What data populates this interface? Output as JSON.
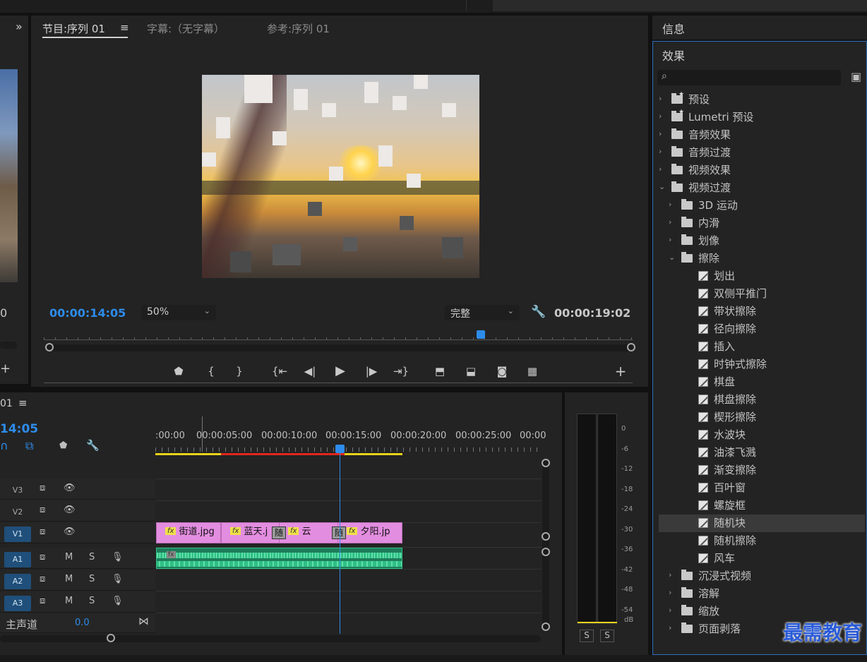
{
  "program_monitor": {
    "tabs": [
      "节目:序列 01",
      "字幕:（无字幕）",
      "参考:序列 01"
    ],
    "current_timecode": "00:00:14:05",
    "zoom": "50%",
    "quality": "完整",
    "duration_timecode": "00:00:19:02",
    "playhead_fraction": 0.74,
    "menu_icon": "hamburger-icon"
  },
  "source_panel": {
    "expand_icon": "double-chevron-right-icon",
    "partial_value": "0"
  },
  "timeline": {
    "sequence_name": "01",
    "current_timecode": "14:05",
    "ruler_labels": [
      ":00:00",
      "00:00:05:00",
      "00:00:10:00",
      "00:00:15:00",
      "00:00:20:00",
      "00:00:25:00",
      "00:00"
    ],
    "tracks": [
      {
        "label": "V3",
        "active": false,
        "type": "video"
      },
      {
        "label": "V2",
        "active": false,
        "type": "video"
      },
      {
        "label": "V1",
        "active": true,
        "type": "video"
      },
      {
        "label": "A1",
        "active": true,
        "type": "audio"
      },
      {
        "label": "A2",
        "active": true,
        "type": "audio"
      },
      {
        "label": "A3",
        "active": true,
        "type": "audio"
      }
    ],
    "audio_buttons": {
      "mute": "M",
      "solo": "S"
    },
    "clips": [
      {
        "name": "街道.jpg",
        "fx": "fx"
      },
      {
        "name": "蓝天.j",
        "fx": "fx"
      },
      {
        "name": "云",
        "fx": "fx"
      },
      {
        "name": "夕阳.jp",
        "fx": "fx"
      }
    ],
    "transition_label": "随",
    "master": {
      "label": "主声道",
      "value": "0.0"
    }
  },
  "meter": {
    "scale": [
      "0",
      "-6",
      "-12",
      "-18",
      "-24",
      "-30",
      "-36",
      "-42",
      "-48",
      "-54",
      "dB"
    ],
    "solo_buttons": [
      "S",
      "S"
    ]
  },
  "info_panel": {
    "title": "信息"
  },
  "effects_panel": {
    "title": "效果",
    "search_placeholder": "",
    "items": [
      {
        "label": "预设",
        "kind": "folder-star",
        "level": 0,
        "expanded": false
      },
      {
        "label": "Lumetri 预设",
        "kind": "folder-star",
        "level": 0,
        "expanded": false
      },
      {
        "label": "音频效果",
        "kind": "folder",
        "level": 0,
        "expanded": false
      },
      {
        "label": "音频过渡",
        "kind": "folder",
        "level": 0,
        "expanded": false
      },
      {
        "label": "视频效果",
        "kind": "folder",
        "level": 0,
        "expanded": false
      },
      {
        "label": "视频过渡",
        "kind": "folder",
        "level": 0,
        "expanded": true
      },
      {
        "label": "3D 运动",
        "kind": "folder",
        "level": 1,
        "expanded": false
      },
      {
        "label": "内滑",
        "kind": "folder",
        "level": 1,
        "expanded": false
      },
      {
        "label": "划像",
        "kind": "folder",
        "level": 1,
        "expanded": false
      },
      {
        "label": "擦除",
        "kind": "folder",
        "level": 1,
        "expanded": true
      },
      {
        "label": "划出",
        "kind": "effect",
        "level": 2
      },
      {
        "label": "双侧平推门",
        "kind": "effect",
        "level": 2
      },
      {
        "label": "带状擦除",
        "kind": "effect",
        "level": 2
      },
      {
        "label": "径向擦除",
        "kind": "effect",
        "level": 2
      },
      {
        "label": "插入",
        "kind": "effect",
        "level": 2
      },
      {
        "label": "时钟式擦除",
        "kind": "effect",
        "level": 2
      },
      {
        "label": "棋盘",
        "kind": "effect",
        "level": 2
      },
      {
        "label": "棋盘擦除",
        "kind": "effect",
        "level": 2
      },
      {
        "label": "楔形擦除",
        "kind": "effect",
        "level": 2
      },
      {
        "label": "水波块",
        "kind": "effect",
        "level": 2
      },
      {
        "label": "油漆飞溅",
        "kind": "effect",
        "level": 2
      },
      {
        "label": "渐变擦除",
        "kind": "effect",
        "level": 2
      },
      {
        "label": "百叶窗",
        "kind": "effect",
        "level": 2
      },
      {
        "label": "螺旋框",
        "kind": "effect",
        "level": 2
      },
      {
        "label": "随机块",
        "kind": "effect",
        "level": 2,
        "selected": true
      },
      {
        "label": "随机擦除",
        "kind": "effect",
        "level": 2
      },
      {
        "label": "风车",
        "kind": "effect",
        "level": 2
      },
      {
        "label": "沉浸式视频",
        "kind": "folder",
        "level": 1,
        "expanded": false
      },
      {
        "label": "溶解",
        "kind": "folder",
        "level": 1,
        "expanded": false
      },
      {
        "label": "缩放",
        "kind": "folder",
        "level": 1,
        "expanded": false
      },
      {
        "label": "页面剥落",
        "kind": "folder",
        "level": 1,
        "expanded": false
      }
    ]
  },
  "watermark": "最需教育",
  "colors": {
    "accent_blue": "#2d8ceb",
    "work_area_yellow": "#e8d31b",
    "render_red": "#e0261e",
    "clip_pink": "#e38de0",
    "audio_green": "#2fbf86",
    "selection_border": "#2e6dbe"
  }
}
